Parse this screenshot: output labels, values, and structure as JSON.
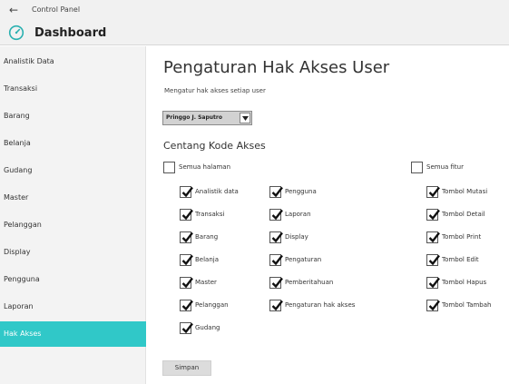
{
  "window": {
    "back_icon": "arrow-left-icon",
    "control_panel": "Control Panel",
    "app_icon": "dashboard-gauge-icon",
    "title": "Dashboard"
  },
  "sidebar": {
    "items": [
      {
        "label": "Analistik Data"
      },
      {
        "label": "Transaksi"
      },
      {
        "label": "Barang"
      },
      {
        "label": "Belanja"
      },
      {
        "label": "Gudang"
      },
      {
        "label": "Master"
      },
      {
        "label": "Pelanggan"
      },
      {
        "label": "Display"
      },
      {
        "label": "Pengguna"
      },
      {
        "label": "Laporan"
      },
      {
        "label": "Hak Akses",
        "active": true
      }
    ]
  },
  "main": {
    "title": "Pengaturan Hak Akses User",
    "subtitle": "Mengatur hak akses setiap user",
    "user_select": {
      "value": "Pringgo J. Saputro"
    },
    "section_title": "Centang Kode Akses",
    "select_all_pages": {
      "label": "Semua halaman",
      "checked": false
    },
    "select_all_features": {
      "label": "Semua fitur",
      "checked": false
    },
    "pages_col1": [
      {
        "label": "Analistik data",
        "checked": true
      },
      {
        "label": "Transaksi",
        "checked": true
      },
      {
        "label": "Barang",
        "checked": true
      },
      {
        "label": "Belanja",
        "checked": true
      },
      {
        "label": "Master",
        "checked": true
      },
      {
        "label": "Pelanggan",
        "checked": true
      },
      {
        "label": "Gudang",
        "checked": true
      }
    ],
    "pages_col2": [
      {
        "label": "Pengguna",
        "checked": true
      },
      {
        "label": "Laporan",
        "checked": true
      },
      {
        "label": "Display",
        "checked": true
      },
      {
        "label": "Pengaturan",
        "checked": true
      },
      {
        "label": "Pemberitahuan",
        "checked": true
      },
      {
        "label": "Pengaturan hak akses",
        "checked": true
      }
    ],
    "features": [
      {
        "label": "Tombol Mutasi",
        "checked": true
      },
      {
        "label": "Tombol Detail",
        "checked": true
      },
      {
        "label": "Tombol Print",
        "checked": true
      },
      {
        "label": "Tombol Edit",
        "checked": true
      },
      {
        "label": "Tombol Hapus",
        "checked": true
      },
      {
        "label": "Tombol Tambah",
        "checked": true
      }
    ],
    "save_label": "Simpan"
  },
  "colors": {
    "accent": "#30c8c8",
    "sidebar_bg": "#f3f3f3",
    "topbar_bg": "#f1f1f1"
  }
}
